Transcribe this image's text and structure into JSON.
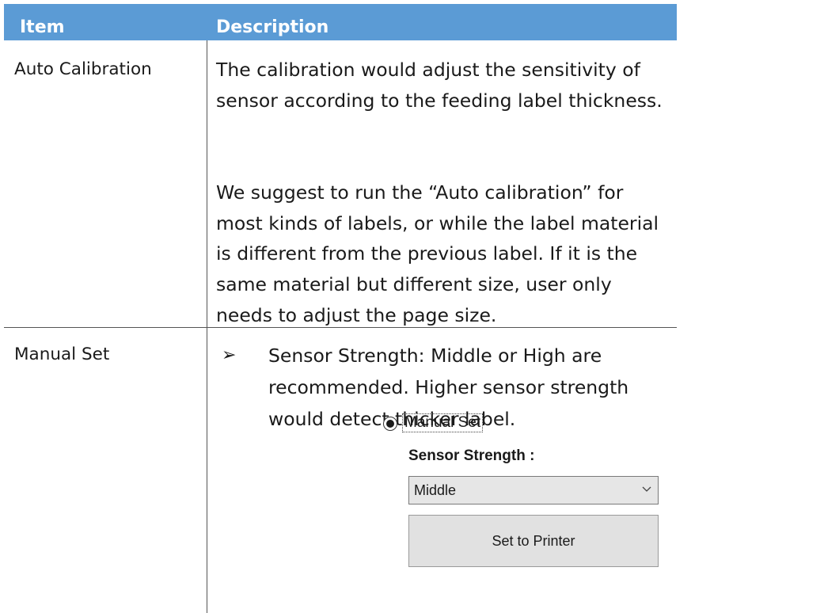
{
  "table": {
    "headers": {
      "item": "Item",
      "description": "Description"
    },
    "rows": [
      {
        "item": "Auto Calibration",
        "paragraphs": [
          "The calibration would adjust the sensitivity of sensor according to the feeding label thickness.",
          "We suggest to run the “Auto calibration” for most kinds of labels, or while the label material is different from the previous label. If it is the same material but different size, user only needs to adjust the page size."
        ]
      },
      {
        "item": "Manual Set",
        "bullet_glyph": "➢",
        "bullet_text": "Sensor Strength: Middle or High are recommended. Higher sensor strength would detect thicker label."
      }
    ]
  },
  "panel": {
    "radio_label": "Manual Set",
    "strength_label": "Sensor Strength :",
    "select_value": "Middle",
    "button_label": "Set to Printer",
    "icons": {
      "radio": "radio-selected-icon",
      "dropdown": "chevron-down-icon"
    }
  },
  "colors": {
    "header_bg": "#5b9bd5",
    "header_text": "#ffffff"
  }
}
